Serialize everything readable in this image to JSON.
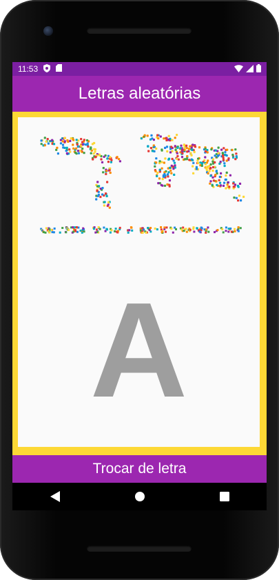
{
  "status_bar": {
    "time": "11:53",
    "icons": [
      "shield-icon",
      "sd-card-icon",
      "wifi-icon",
      "signal-icon",
      "battery-icon"
    ]
  },
  "app_bar": {
    "title": "Letras aleatórias"
  },
  "content": {
    "current_letter": "A",
    "map_image_description": "world-map-made-of-colorful-letters"
  },
  "action_button": {
    "label": "Trocar de letra"
  },
  "nav_bar": {
    "icons": [
      "back-icon",
      "home-icon",
      "recents-icon"
    ]
  },
  "colors": {
    "status_bar": "#7b1fa2",
    "app_bar": "#9c27b0",
    "frame": "#fdd835",
    "letter": "#9e9e9e"
  }
}
